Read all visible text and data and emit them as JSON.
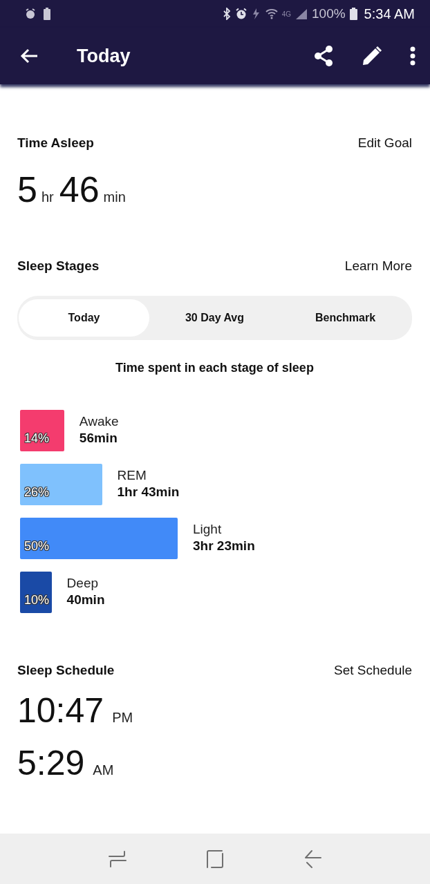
{
  "status_bar": {
    "network": "4G",
    "battery": "100%",
    "time": "5:34 AM"
  },
  "app_bar": {
    "title": "Today"
  },
  "time_asleep": {
    "title": "Time Asleep",
    "action": "Edit Goal",
    "hours": "5",
    "hours_unit": "hr",
    "minutes": "46",
    "minutes_unit": "min"
  },
  "sleep_stages": {
    "title": "Sleep Stages",
    "action": "Learn More",
    "tabs": [
      {
        "label": "Today",
        "selected": true
      },
      {
        "label": "30 Day Avg",
        "selected": false
      },
      {
        "label": "Benchmark",
        "selected": false
      }
    ],
    "subtitle": "Time spent in each stage of sleep",
    "stages": [
      {
        "name": "Awake",
        "duration": "56min",
        "percent": "14%",
        "color": "#f43c6e"
      },
      {
        "name": "REM",
        "duration": "1hr 43min",
        "percent": "26%",
        "color": "#7fc1fd"
      },
      {
        "name": "Light",
        "duration": "3hr 23min",
        "percent": "50%",
        "color": "#418af8"
      },
      {
        "name": "Deep",
        "duration": "40min",
        "percent": "10%",
        "color": "#1a4aa6"
      }
    ]
  },
  "sleep_schedule": {
    "title": "Sleep Schedule",
    "action": "Set Schedule",
    "times": [
      {
        "time": "10:47",
        "period": "PM"
      },
      {
        "time": "5:29",
        "period": "AM"
      }
    ]
  }
}
